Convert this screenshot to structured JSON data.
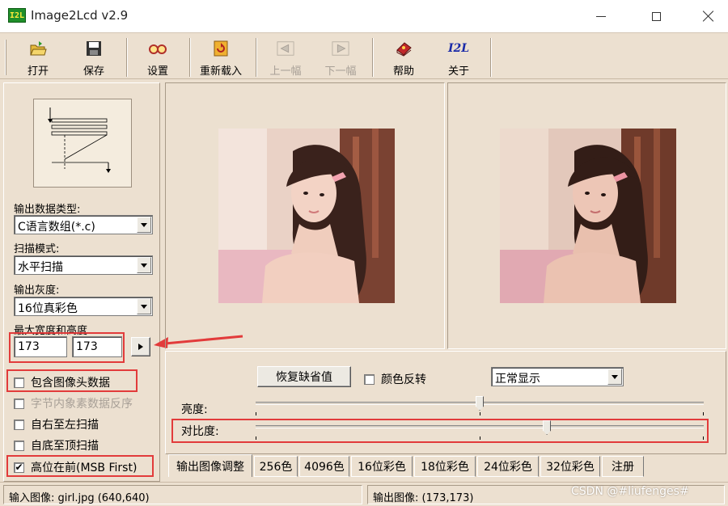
{
  "window": {
    "title": "Image2Lcd v2.9",
    "icon_text": "I2L"
  },
  "toolbar": {
    "open": "打开",
    "save": "保存",
    "settings": "设置",
    "reload": "重新载入",
    "prev": "上一幅",
    "next": "下一幅",
    "help": "帮助",
    "about": "关于",
    "about_icon_text": "I2L"
  },
  "left": {
    "output_type_label": "输出数据类型:",
    "output_type_value": "C语言数组(*.c)",
    "scan_mode_label": "扫描模式:",
    "scan_mode_value": "水平扫描",
    "gray_label": "输出灰度:",
    "gray_value": "16位真彩色",
    "size_label": "最大宽度和高度",
    "max_width": "173",
    "max_height": "173",
    "options": [
      {
        "label": "包含图像头数据",
        "checked": false,
        "enabled": true
      },
      {
        "label": "字节内象素数据反序",
        "checked": false,
        "enabled": false
      },
      {
        "label": "自右至左扫描",
        "checked": false,
        "enabled": true
      },
      {
        "label": "自底至顶扫描",
        "checked": false,
        "enabled": true
      },
      {
        "label": "高位在前(MSB First)",
        "checked": true,
        "enabled": true
      }
    ]
  },
  "adjust": {
    "restore_default": "恢复缺省值",
    "invert_color_label": "颜色反转",
    "display_mode_value": "正常显示",
    "brightness_label": "亮度:",
    "contrast_label": "对比度:",
    "brightness_level": 0.5,
    "contrast_level": 0.65
  },
  "tabs": [
    "输出图像调整",
    "256色",
    "4096色",
    "16位彩色",
    "18位彩色",
    "24位彩色",
    "32位彩色",
    "注册"
  ],
  "status": {
    "input_image": "输入图像: girl.jpg (640,640)",
    "output_image": "输出图像: (173,173)"
  },
  "watermark": "CSDN @#liufenges#",
  "colors": {
    "highlight_red": "#e23b3b",
    "window_bg": "#ece0d0"
  }
}
